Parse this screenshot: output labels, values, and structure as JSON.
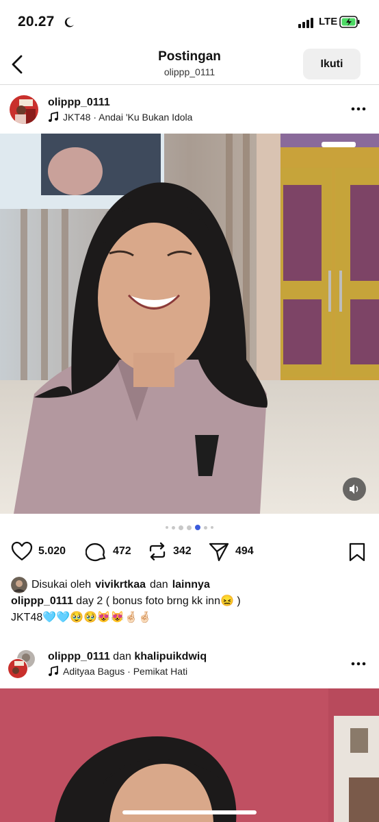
{
  "status_bar": {
    "time": "20.27",
    "network": "LTE"
  },
  "header": {
    "title": "Postingan",
    "subtitle": "olippp_0111",
    "follow_label": "Ikuti"
  },
  "post": {
    "username": "olippp_0111",
    "audio": "JKT48 · Andai 'Ku Bukan Idola",
    "carousel": {
      "count": 7,
      "active_index": 4
    },
    "actions": {
      "likes": "5.020",
      "comments": "472",
      "reposts": "342",
      "shares": "494"
    },
    "liked_by": {
      "prefix": "Disukai oleh",
      "user": "vivikrtkaa",
      "joiner": "dan",
      "others": "lainnya"
    },
    "caption": {
      "username": "olippp_0111",
      "text": "day 2 ( bonus foto brng kk inn😖 )",
      "line2": "JKT48🩵🩵🥹🥹😻😻🤞🏻🤞🏻"
    }
  },
  "next_post": {
    "username": "olippp_0111",
    "joiner": "dan",
    "coauthor": "khalipuikdwiq",
    "audio": "Adityaa Bagus · Pemikat Hati"
  },
  "colors": {
    "accent_blue": "#3b5bdb",
    "battery_green": "#4cd964",
    "follow_bg": "#efefef"
  }
}
